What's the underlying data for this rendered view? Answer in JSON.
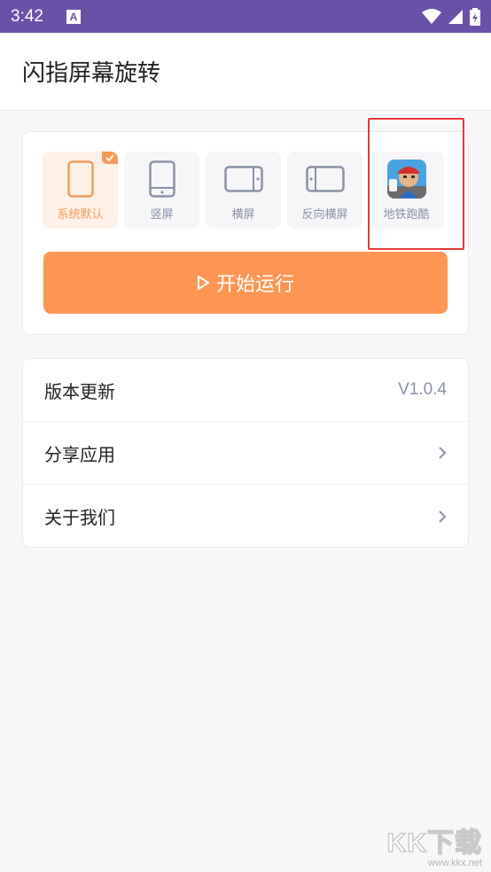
{
  "status_bar": {
    "time": "3:42",
    "notification_badge": "A",
    "icons": [
      "wifi-icon",
      "signal-icon",
      "battery-charging-icon"
    ]
  },
  "app_bar": {
    "title": "闪指屏幕旋转"
  },
  "modes": [
    {
      "label": "系统默认",
      "icon": "phone-outline-icon",
      "selected": true
    },
    {
      "label": "竖屏",
      "icon": "portrait-icon",
      "selected": false
    },
    {
      "label": "横屏",
      "icon": "landscape-icon",
      "selected": false
    },
    {
      "label": "反向横屏",
      "icon": "reverse-landscape-icon",
      "selected": false
    },
    {
      "label": "地铁跑酷",
      "icon": "subway-surfers-game-icon",
      "selected": false
    }
  ],
  "start_button": {
    "label": "开始运行",
    "icon": "play-icon"
  },
  "menu": [
    {
      "label": "版本更新",
      "value": "V1.0.4"
    },
    {
      "label": "分享应用",
      "icon": "chevron-right-icon"
    },
    {
      "label": "关于我们",
      "icon": "chevron-right-icon"
    }
  ],
  "watermark": {
    "logo": "KK下载",
    "url": "www.kkx.net"
  },
  "colors": {
    "status_bar": "#6a51a8",
    "accent": "#fd9652",
    "selected_bg": "#fdf1e8",
    "highlight": "#e53935"
  }
}
